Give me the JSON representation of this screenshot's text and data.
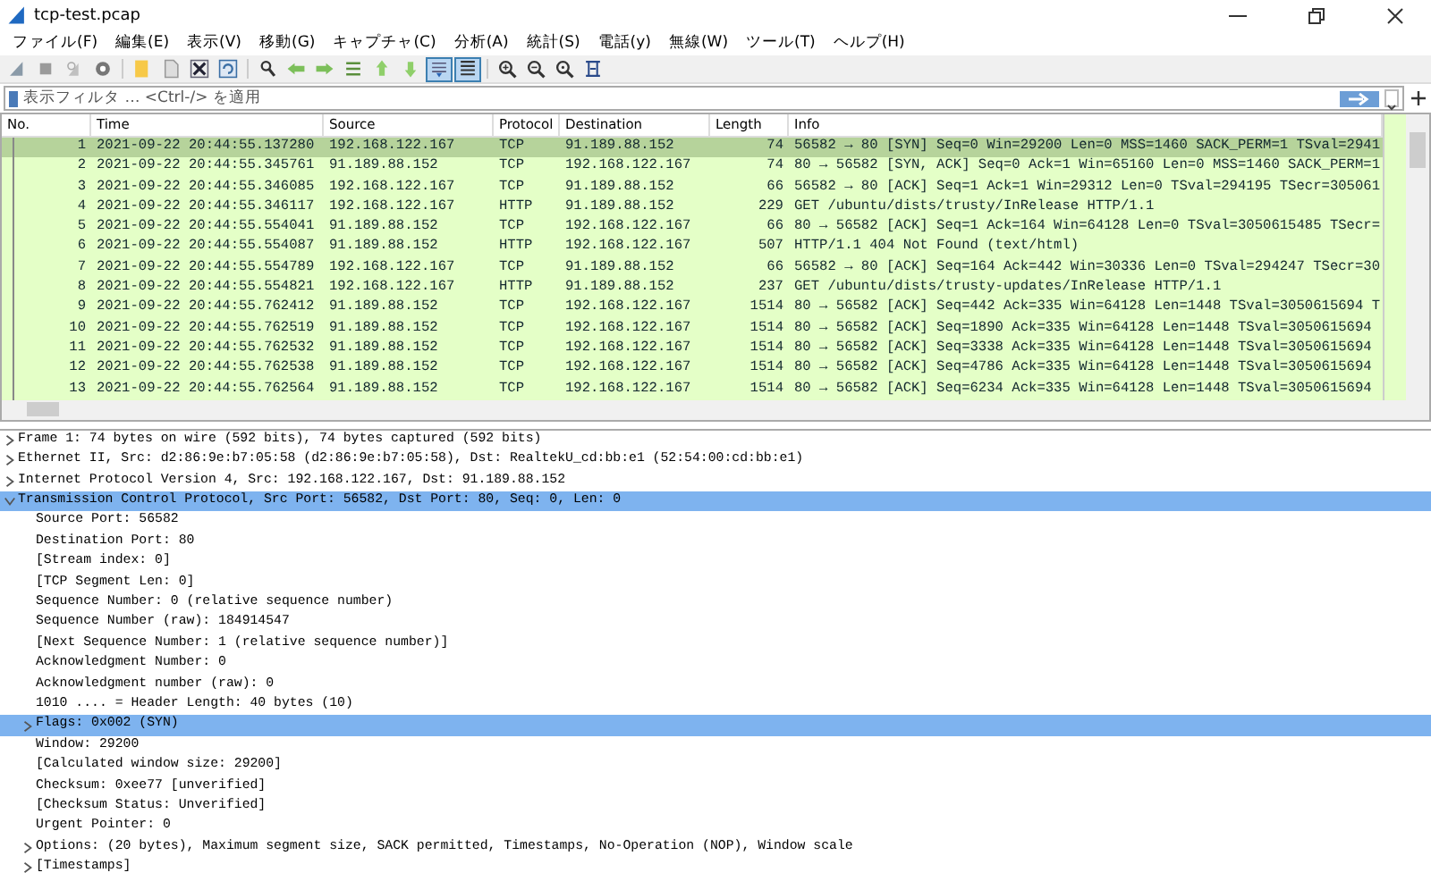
{
  "window": {
    "title": "tcp-test.pcap"
  },
  "menu": [
    "ファイル(F)",
    "編集(E)",
    "表示(V)",
    "移動(G)",
    "キャプチャ(C)",
    "分析(A)",
    "統計(S)",
    "電話(y)",
    "無線(W)",
    "ツール(T)",
    "ヘルプ(H)"
  ],
  "toolbar": [
    [
      {
        "kind": "fin",
        "pressed": false
      },
      {
        "kind": "stop",
        "pressed": false
      },
      {
        "kind": "restart",
        "pressed": false
      },
      {
        "kind": "gear",
        "pressed": false
      }
    ],
    [
      {
        "kind": "folder",
        "pressed": false
      },
      {
        "kind": "file",
        "pressed": false
      },
      {
        "kind": "close",
        "pressed": false
      },
      {
        "kind": "reload",
        "pressed": false
      }
    ],
    [
      {
        "kind": "search",
        "pressed": false
      },
      {
        "kind": "back",
        "pressed": false
      },
      {
        "kind": "forward",
        "pressed": false
      },
      {
        "kind": "goto",
        "pressed": false
      },
      {
        "kind": "first",
        "pressed": false
      },
      {
        "kind": "last",
        "pressed": false
      },
      {
        "kind": "autoscroll",
        "pressed": true
      },
      {
        "kind": "lines",
        "pressed": true
      }
    ],
    [
      {
        "kind": "zoomin",
        "pressed": false
      },
      {
        "kind": "zoomout",
        "pressed": false
      },
      {
        "kind": "zoomreset",
        "pressed": false
      },
      {
        "kind": "columns",
        "pressed": false
      }
    ]
  ],
  "filter": {
    "placeholder": "表示フィルタ … <Ctrl-/> を適用"
  },
  "packet_list": {
    "columns": [
      "No.",
      "Time",
      "Source",
      "Protocol",
      "Destination",
      "Length",
      "Info"
    ],
    "rows": [
      {
        "no": "1",
        "time": "2021-09-22 20:44:55.137280",
        "source": "192.168.122.167",
        "protocol": "TCP",
        "destination": "91.189.88.152",
        "length": "74",
        "info": "56582 → 80 [SYN] Seq=0 Win=29200 Len=0 MSS=1460 SACK_PERM=1 TSval=2941",
        "selected": true
      },
      {
        "no": "2",
        "time": "2021-09-22 20:44:55.345761",
        "source": "91.189.88.152",
        "protocol": "TCP",
        "destination": "192.168.122.167",
        "length": "74",
        "info": "80 → 56582 [SYN, ACK] Seq=0 Ack=1 Win=65160 Len=0 MSS=1460 SACK_PERM=1",
        "selected": false
      },
      {
        "no": "3",
        "time": "2021-09-22 20:44:55.346085",
        "source": "192.168.122.167",
        "protocol": "TCP",
        "destination": "91.189.88.152",
        "length": "66",
        "info": "56582 → 80 [ACK] Seq=1 Ack=1 Win=29312 Len=0 TSval=294195 TSecr=305061",
        "selected": false
      },
      {
        "no": "4",
        "time": "2021-09-22 20:44:55.346117",
        "source": "192.168.122.167",
        "protocol": "HTTP",
        "destination": "91.189.88.152",
        "length": "229",
        "info": "GET /ubuntu/dists/trusty/InRelease HTTP/1.1",
        "selected": false
      },
      {
        "no": "5",
        "time": "2021-09-22 20:44:55.554041",
        "source": "91.189.88.152",
        "protocol": "TCP",
        "destination": "192.168.122.167",
        "length": "66",
        "info": "80 → 56582 [ACK] Seq=1 Ack=164 Win=64128 Len=0 TSval=3050615485 TSecr=",
        "selected": false
      },
      {
        "no": "6",
        "time": "2021-09-22 20:44:55.554087",
        "source": "91.189.88.152",
        "protocol": "HTTP",
        "destination": "192.168.122.167",
        "length": "507",
        "info": "HTTP/1.1 404 Not Found  (text/html)",
        "selected": false
      },
      {
        "no": "7",
        "time": "2021-09-22 20:44:55.554789",
        "source": "192.168.122.167",
        "protocol": "TCP",
        "destination": "91.189.88.152",
        "length": "66",
        "info": "56582 → 80 [ACK] Seq=164 Ack=442 Win=30336 Len=0 TSval=294247 TSecr=30",
        "selected": false
      },
      {
        "no": "8",
        "time": "2021-09-22 20:44:55.554821",
        "source": "192.168.122.167",
        "protocol": "HTTP",
        "destination": "91.189.88.152",
        "length": "237",
        "info": "GET /ubuntu/dists/trusty-updates/InRelease HTTP/1.1",
        "selected": false
      },
      {
        "no": "9",
        "time": "2021-09-22 20:44:55.762412",
        "source": "91.189.88.152",
        "protocol": "TCP",
        "destination": "192.168.122.167",
        "length": "1514",
        "info": "80 → 56582 [ACK] Seq=442 Ack=335 Win=64128 Len=1448 TSval=3050615694 T",
        "selected": false
      },
      {
        "no": "10",
        "time": "2021-09-22 20:44:55.762519",
        "source": "91.189.88.152",
        "protocol": "TCP",
        "destination": "192.168.122.167",
        "length": "1514",
        "info": "80 → 56582 [ACK] Seq=1890 Ack=335 Win=64128 Len=1448 TSval=3050615694",
        "selected": false
      },
      {
        "no": "11",
        "time": "2021-09-22 20:44:55.762532",
        "source": "91.189.88.152",
        "protocol": "TCP",
        "destination": "192.168.122.167",
        "length": "1514",
        "info": "80 → 56582 [ACK] Seq=3338 Ack=335 Win=64128 Len=1448 TSval=3050615694",
        "selected": false
      },
      {
        "no": "12",
        "time": "2021-09-22 20:44:55.762538",
        "source": "91.189.88.152",
        "protocol": "TCP",
        "destination": "192.168.122.167",
        "length": "1514",
        "info": "80 → 56582 [ACK] Seq=4786 Ack=335 Win=64128 Len=1448 TSval=3050615694",
        "selected": false
      },
      {
        "no": "13",
        "time": "2021-09-22 20:44:55.762564",
        "source": "91.189.88.152",
        "protocol": "TCP",
        "destination": "192.168.122.167",
        "length": "1514",
        "info": "80 → 56582 [ACK] Seq=6234 Ack=335 Win=64128 Len=1448 TSval=3050615694",
        "selected": false
      }
    ]
  },
  "details": [
    {
      "kind": "node",
      "text": "Frame 1: 74 bytes on wire (592 bits), 74 bytes captured (592 bits)",
      "expanded": false,
      "selected": false
    },
    {
      "kind": "node",
      "text": "Ethernet II, Src: d2:86:9e:b7:05:58 (d2:86:9e:b7:05:58), Dst: RealtekU_cd:bb:e1 (52:54:00:cd:bb:e1)",
      "expanded": false,
      "selected": false
    },
    {
      "kind": "node",
      "text": "Internet Protocol Version 4, Src: 192.168.122.167, Dst: 91.189.88.152",
      "expanded": false,
      "selected": false
    },
    {
      "kind": "node",
      "text": "Transmission Control Protocol, Src Port: 56582, Dst Port: 80, Seq: 0, Len: 0",
      "expanded": true,
      "selected": true,
      "children": [
        {
          "kind": "leaf",
          "text": "Source Port: 56582",
          "selected": false
        },
        {
          "kind": "leaf",
          "text": "Destination Port: 80",
          "selected": false
        },
        {
          "kind": "leaf",
          "text": "[Stream index: 0]",
          "selected": false
        },
        {
          "kind": "leaf",
          "text": "[TCP Segment Len: 0]",
          "selected": false
        },
        {
          "kind": "leaf",
          "text": "Sequence Number: 0    (relative sequence number)",
          "selected": false
        },
        {
          "kind": "leaf",
          "text": "Sequence Number (raw): 184914547",
          "selected": false
        },
        {
          "kind": "leaf",
          "text": "[Next Sequence Number: 1    (relative sequence number)]",
          "selected": false
        },
        {
          "kind": "leaf",
          "text": "Acknowledgment Number: 0",
          "selected": false
        },
        {
          "kind": "leaf",
          "text": "Acknowledgment number (raw): 0",
          "selected": false
        },
        {
          "kind": "leaf",
          "text": "1010 .... = Header Length: 40 bytes (10)",
          "selected": false
        },
        {
          "kind": "node",
          "text": "Flags: 0x002 (SYN)",
          "expanded": false,
          "selected": true
        },
        {
          "kind": "leaf",
          "text": "Window: 29200",
          "selected": false
        },
        {
          "kind": "leaf",
          "text": "[Calculated window size: 29200]",
          "selected": false
        },
        {
          "kind": "leaf",
          "text": "Checksum: 0xee77 [unverified]",
          "selected": false
        },
        {
          "kind": "leaf",
          "text": "[Checksum Status: Unverified]",
          "selected": false
        },
        {
          "kind": "leaf",
          "text": "Urgent Pointer: 0",
          "selected": false
        },
        {
          "kind": "node",
          "text": "Options: (20 bytes), Maximum segment size, SACK permitted, Timestamps, No-Operation (NOP), Window scale",
          "expanded": false,
          "selected": false
        },
        {
          "kind": "node",
          "text": "[Timestamps]",
          "expanded": false,
          "selected": false
        }
      ]
    }
  ]
}
